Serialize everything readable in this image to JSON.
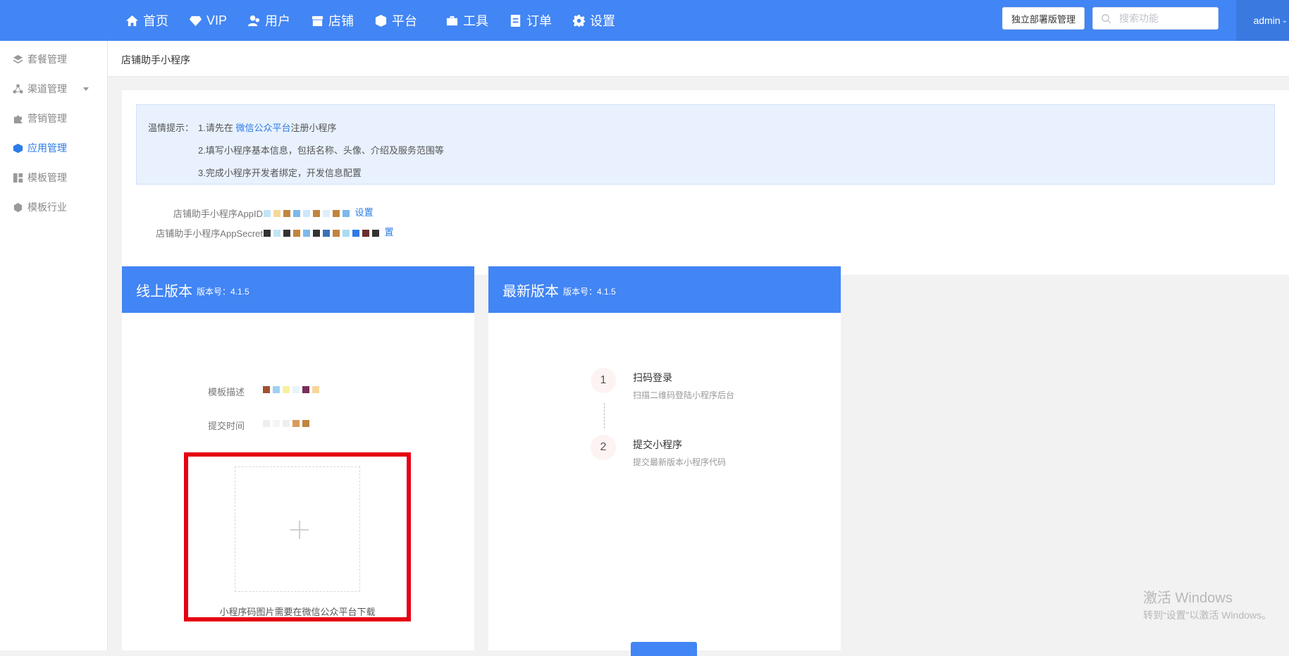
{
  "nav": {
    "items": [
      {
        "label": "首页",
        "icon": "home-icon"
      },
      {
        "label": "VIP",
        "icon": "diamond-icon"
      },
      {
        "label": "用户",
        "icon": "user-icon"
      },
      {
        "label": "店铺",
        "icon": "shop-icon"
      },
      {
        "label": "平台",
        "icon": "cube-icon"
      },
      {
        "label": "工具",
        "icon": "briefcase-icon"
      },
      {
        "label": "订单",
        "icon": "document-icon"
      },
      {
        "label": "设置",
        "icon": "gear-icon"
      }
    ],
    "deploy_button": "独立部署版管理",
    "search_placeholder": "搜索功能",
    "user": "admin"
  },
  "sidebar": {
    "items": [
      {
        "label": "套餐管理",
        "icon": "layers-icon"
      },
      {
        "label": "渠道管理",
        "icon": "network-icon"
      },
      {
        "label": "营销管理",
        "icon": "puzzle-icon"
      },
      {
        "label": "应用管理",
        "icon": "cube-icon",
        "active": true
      },
      {
        "label": "模板管理",
        "icon": "grid-icon"
      },
      {
        "label": "模板行业",
        "icon": "hexagon-icon"
      }
    ]
  },
  "page": {
    "title": "店铺助手小程序"
  },
  "tip": {
    "label": "温情提示：",
    "line1_prefix": "1.请先在 ",
    "line1_link": "微信公众平台",
    "line1_suffix": "注册小程序",
    "line2": "2.填写小程序基本信息，包括名称、头像、介绍及服务范围等",
    "line3": "3.完成小程序开发者绑定，开发信息配置"
  },
  "fields": {
    "appid_label": "店铺助手小程序AppID",
    "appid_link": "设置",
    "secret_label": "店铺助手小程序AppSecret",
    "secret_link": "置"
  },
  "online": {
    "title": "线上版本",
    "version": "版本号：4.1.5",
    "template_label": "模板描述",
    "submit_time_label": "提交时间",
    "qr_caption": "小程序码图片需要在微信公众平台下载"
  },
  "latest": {
    "title": "最新版本",
    "version": "版本号：4.1.5",
    "steps": [
      {
        "num": "1",
        "title": "扫码登录",
        "desc": "扫描二维码登陆小程序后台"
      },
      {
        "num": "2",
        "title": "提交小程序",
        "desc": "提交最新版本小程序代码"
      }
    ]
  },
  "watermark": {
    "line1": "激活 Windows",
    "line2": "转到“设置”以激活 Windows。"
  },
  "colors": {
    "primary": "#4285f4",
    "highlight_border": "#e60012"
  }
}
